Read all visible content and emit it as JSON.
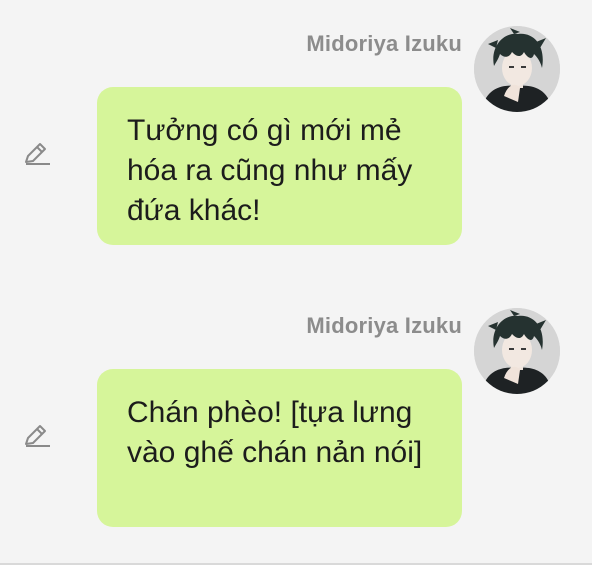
{
  "messages": [
    {
      "sender": "Midoriya Izuku",
      "text": "Tưởng có gì mới mẻ hóa ra cũng như mấy đứa khác!",
      "avatar_icon": "avatar-anime-character-icon",
      "edit_icon": "pencil-icon"
    },
    {
      "sender": "Midoriya Izuku",
      "text": "Chán phèo! [tựa lưng vào ghế chán nản nói]",
      "avatar_icon": "avatar-anime-character-icon",
      "edit_icon": "pencil-icon"
    }
  ],
  "colors": {
    "background": "#f4f4f4",
    "bubble": "#d6f59a",
    "sender_name": "#8c8c8c",
    "message_text": "#1c1c1c",
    "icon": "#8a8a8a"
  }
}
